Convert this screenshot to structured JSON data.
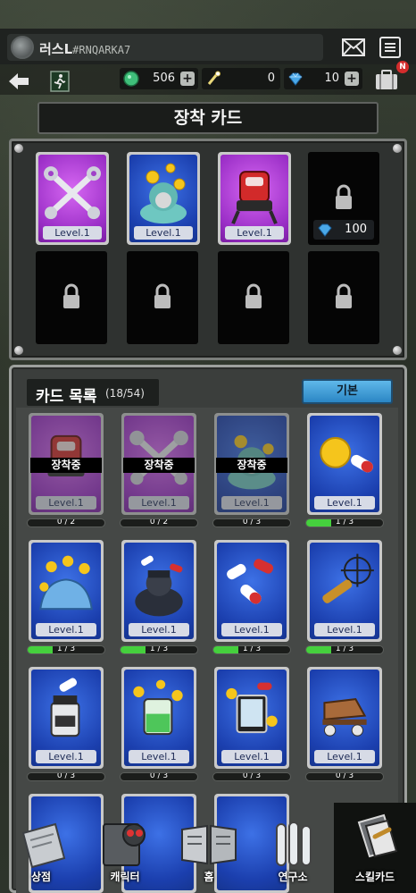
{
  "player": {
    "name": "러스L",
    "tag": "#RNQARKA7"
  },
  "resources": [
    {
      "icon": "green-gem-icon",
      "value": "506"
    },
    {
      "icon": "key-icon",
      "value": "0"
    },
    {
      "icon": "blue-gem-icon",
      "value": "10"
    }
  ],
  "badge": "N",
  "title": "장착 카드",
  "equipped": {
    "slots": [
      {
        "card": "wrench",
        "level": "Level.1"
      },
      {
        "card": "cleaner",
        "level": "Level.1"
      },
      {
        "card": "robot",
        "level": "Level.1"
      },
      {
        "unlock_cost": "100"
      }
    ],
    "locked_slots": 4
  },
  "list": {
    "title": "카드 목록",
    "count": "(18/54)",
    "sort_label": "기본",
    "equipped_label": "장착중",
    "cards": [
      {
        "art": "robot",
        "color": "purple",
        "level": "Level.1",
        "progress": "0 / 2",
        "fill": 0,
        "equipped": true
      },
      {
        "art": "wrench",
        "color": "purple",
        "level": "Level.1",
        "progress": "0 / 2",
        "fill": 0,
        "equipped": true
      },
      {
        "art": "cleaner",
        "color": "blue",
        "level": "Level.1",
        "progress": "0 / 3",
        "fill": 0,
        "equipped": true
      },
      {
        "art": "coin-pill",
        "color": "blue",
        "level": "Level.1",
        "progress": "1 / 3",
        "fill": 0.33,
        "equipped": false
      },
      {
        "art": "blob",
        "color": "blue",
        "level": "Level.1",
        "progress": "1 / 3",
        "fill": 0.33,
        "equipped": false
      },
      {
        "art": "brute",
        "color": "blue",
        "level": "Level.1",
        "progress": "1 / 3",
        "fill": 0.33,
        "equipped": false
      },
      {
        "art": "pills",
        "color": "blue",
        "level": "Level.1",
        "progress": "1 / 3",
        "fill": 0.33,
        "equipped": false
      },
      {
        "art": "bullet",
        "color": "blue",
        "level": "Level.1",
        "progress": "1 / 3",
        "fill": 0.33,
        "equipped": false
      },
      {
        "art": "bottle",
        "color": "blue",
        "level": "Level.1",
        "progress": "0 / 3",
        "fill": 0,
        "equipped": false
      },
      {
        "art": "iv-bag",
        "color": "blue",
        "level": "Level.1",
        "progress": "0 / 3",
        "fill": 0,
        "equipped": false
      },
      {
        "art": "tablet",
        "color": "blue",
        "level": "Level.1",
        "progress": "0 / 3",
        "fill": 0,
        "equipped": false
      },
      {
        "art": "skate",
        "color": "blue",
        "level": "Level.1",
        "progress": "0 / 3",
        "fill": 0,
        "equipped": false
      }
    ]
  },
  "nav": [
    {
      "label": "상점",
      "icon": "shop-icon"
    },
    {
      "label": "캐릭터",
      "icon": "character-icon"
    },
    {
      "label": "홈",
      "icon": "home-icon"
    },
    {
      "label": "연구소",
      "icon": "lab-icon"
    },
    {
      "label": "스킬카드",
      "icon": "skillcard-icon",
      "active": true
    }
  ]
}
